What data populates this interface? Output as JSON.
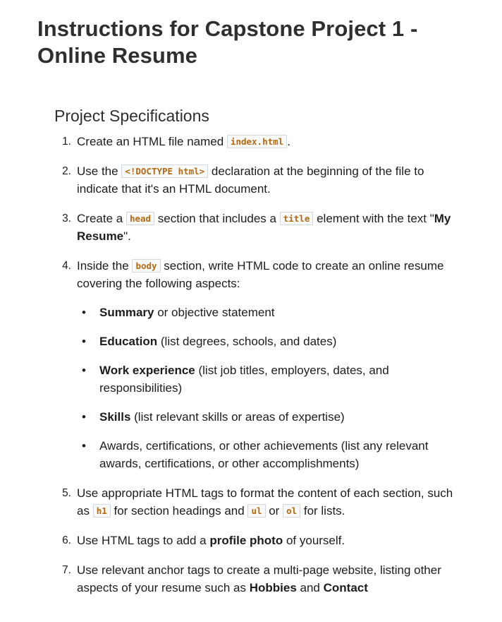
{
  "title": "Instructions for Capstone Project 1 - Online Resume",
  "section_heading": "Project Specifications",
  "items": [
    {
      "number": "1.",
      "text_1": "Create an HTML file named ",
      "code_1": "index.html",
      "text_2": "."
    },
    {
      "number": "2.",
      "text_1": "Use the ",
      "code_1": "<!DOCTYPE html>",
      "text_2": " declaration at the beginning of the file to indicate that it's an HTML document."
    },
    {
      "number": "3.",
      "text_1": "Create a ",
      "code_1": "head",
      "text_2": " section that includes a ",
      "code_2": "title",
      "text_3": " element with the text \"",
      "bold_1": "My Resume",
      "text_4": "\"."
    },
    {
      "number": "4.",
      "text_1": "Inside the ",
      "code_1": "body",
      "text_2": " section, write HTML code to create an online resume covering the following aspects:",
      "bullets": [
        {
          "bold": "Summary",
          "text": " or objective statement"
        },
        {
          "bold": "Education",
          "text": " (list degrees, schools, and dates)"
        },
        {
          "bold": "Work experience",
          "text": " (list job titles, employers, dates, and responsibilities)"
        },
        {
          "bold": "Skills",
          "text": " (list relevant skills or areas of expertise)"
        },
        {
          "bold": "",
          "text": "Awards, certifications, or other achievements (list any relevant awards, certifications, or other accomplishments)"
        }
      ]
    },
    {
      "number": "5.",
      "text_1": "Use appropriate HTML tags to format the content of each section, such as ",
      "code_1": "h1",
      "text_2": " for section headings and ",
      "code_2": "ul",
      "text_3": " or ",
      "code_3": "ol",
      "text_4": " for lists."
    },
    {
      "number": "6.",
      "text_1": "Use HTML tags to add a ",
      "bold_1": "profile photo",
      "text_2": " of yourself."
    },
    {
      "number": "7.",
      "text_1": "Use relevant anchor tags to create a multi-page website, listing other aspects of your resume such as ",
      "bold_1": "Hobbies",
      "text_2": " and ",
      "bold_2": "Contact"
    }
  ],
  "bullet_symbol": "•"
}
